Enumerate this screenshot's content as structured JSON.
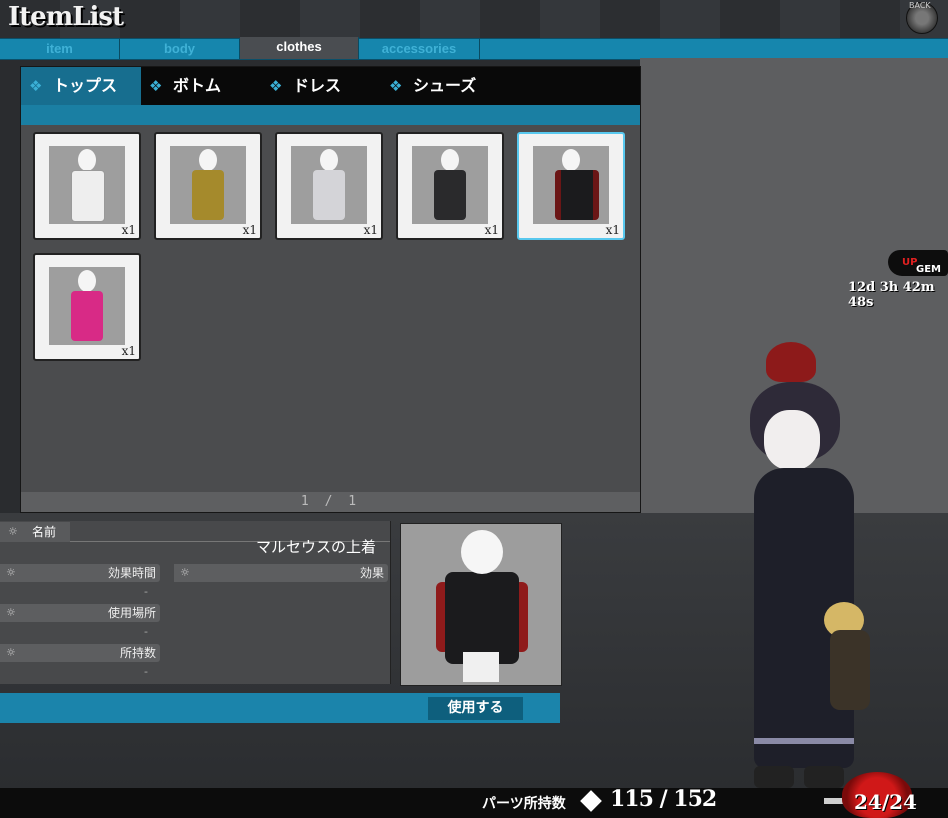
{
  "header": {
    "title": "ItemList",
    "back_label": "BACK"
  },
  "category_tabs": [
    {
      "label": "item",
      "active": false
    },
    {
      "label": "body",
      "active": false
    },
    {
      "label": "clothes",
      "active": true
    },
    {
      "label": "accessories",
      "active": false
    }
  ],
  "sub_tabs": [
    {
      "label": "トップス",
      "active": true
    },
    {
      "label": "ボトム",
      "active": false
    },
    {
      "label": "ドレス",
      "active": false
    },
    {
      "label": "シューズ",
      "active": false
    }
  ],
  "items": [
    {
      "qty": "x1",
      "color": "#eeeeee",
      "selected": false
    },
    {
      "qty": "x1",
      "color": "#a58a2c",
      "selected": false
    },
    {
      "qty": "x1",
      "color": "#d4d4d8",
      "selected": false
    },
    {
      "qty": "x1",
      "color": "#2a2a2c",
      "selected": false
    },
    {
      "qty": "x1",
      "color": "#6b1616",
      "selected": true
    },
    {
      "qty": "x1",
      "color": "#d82a86",
      "selected": false
    }
  ],
  "pager": {
    "text": "1 / 1"
  },
  "gem_badge": {
    "text_a": "GEM",
    "text_b": "UP"
  },
  "timer": "12d 3h 42m 48s",
  "detail": {
    "name_label": "名前",
    "name_value": "マルセウスの上着",
    "duration_label": "効果時間",
    "duration_value": "-",
    "effect_label": "効果",
    "location_label": "使用場所",
    "location_value": "-",
    "owned_label": "所持数",
    "owned_value": "-"
  },
  "use_button": "使用する",
  "status": {
    "parts_label": "パーツ所持数",
    "parts_count": "115 / 152",
    "stamina": "24/24"
  }
}
